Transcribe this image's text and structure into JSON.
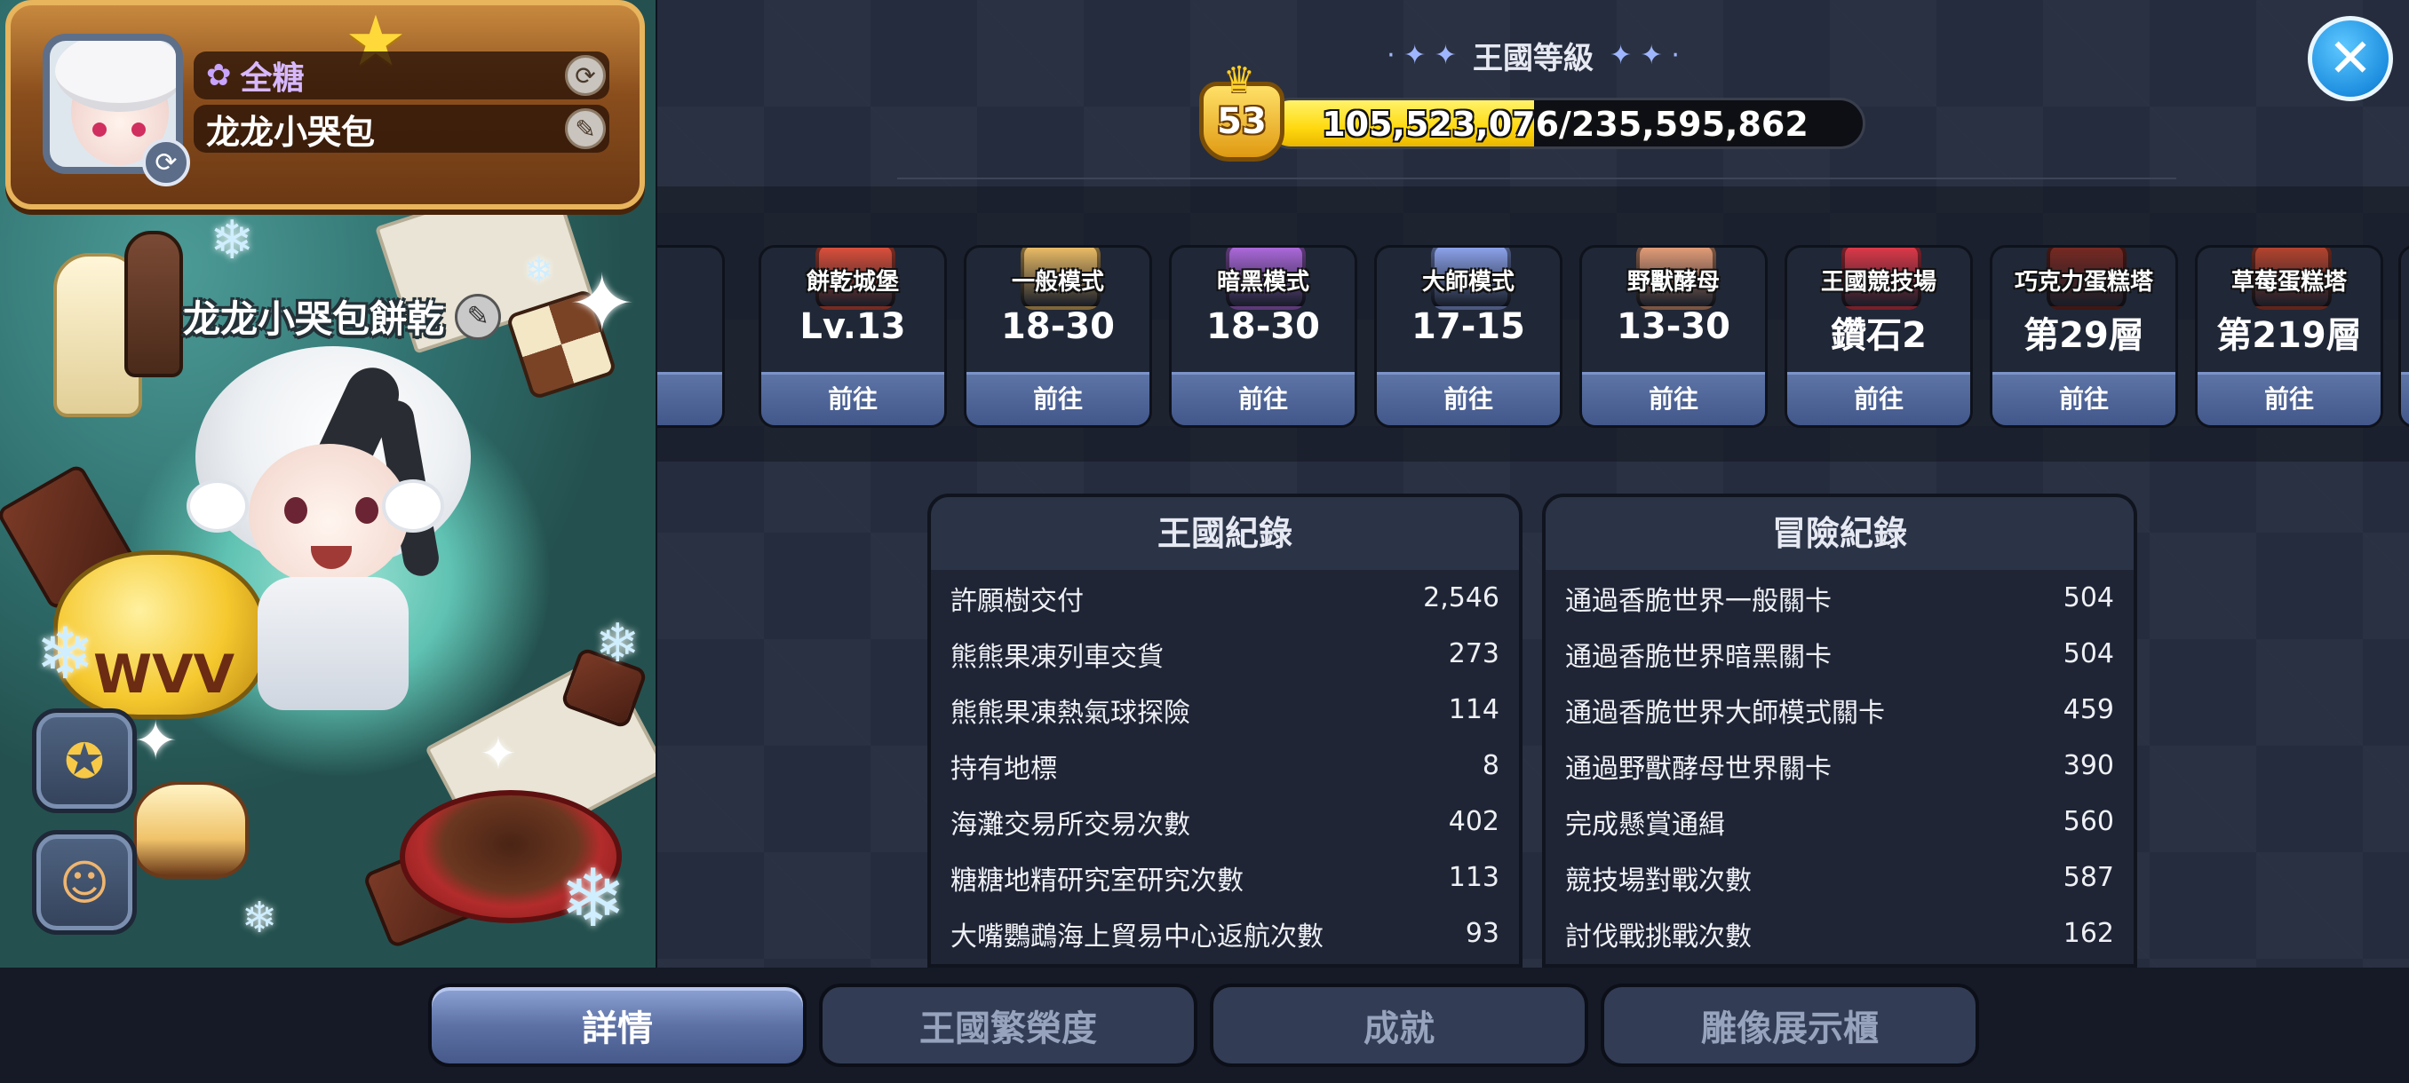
{
  "profile": {
    "title": "全糖",
    "name": "龙龙小哭包",
    "cookie_name": "龙龙小哭包餅乾"
  },
  "kingdom_level": {
    "header": "王國等級",
    "level": "53",
    "xp_text": "105,523,076/235,595,862",
    "xp_fraction": 0.448
  },
  "modes": [
    {
      "label": "餅乾城堡",
      "value": "Lv.13",
      "go": "前往",
      "icon": "castle-icon",
      "color": "#e0513c"
    },
    {
      "label": "一般模式",
      "value": "18-30",
      "go": "前往",
      "icon": "map-icon",
      "color": "#f0c067"
    },
    {
      "label": "暗黑模式",
      "value": "18-30",
      "go": "前往",
      "icon": "dark-map-icon",
      "color": "#b06be0"
    },
    {
      "label": "大師模式",
      "value": "17-15",
      "go": "前往",
      "icon": "master-map-icon",
      "color": "#8fa6f0"
    },
    {
      "label": "野獸酵母",
      "value": "13-30",
      "go": "前往",
      "icon": "beast-map-icon",
      "color": "#e8a07a"
    },
    {
      "label": "王國競技場",
      "value": "鑽石2",
      "go": "前往",
      "icon": "arena-icon",
      "color": "#e23a4a"
    },
    {
      "label": "巧克力蛋糕塔",
      "value": "第29層",
      "go": "前往",
      "icon": "chocolate-tower-icon",
      "color": "#7a2a22"
    },
    {
      "label": "草莓蛋糕塔",
      "value": "第219層",
      "go": "前往",
      "icon": "strawberry-tower-icon",
      "color": "#b8452f"
    }
  ],
  "kingdom_record": {
    "title": "王國紀錄",
    "rows": [
      {
        "label": "許願樹交付",
        "value": "2,546"
      },
      {
        "label": "熊熊果凍列車交貨",
        "value": "273"
      },
      {
        "label": "熊熊果凍熱氣球探險",
        "value": "114"
      },
      {
        "label": "持有地標",
        "value": "8"
      },
      {
        "label": "海灘交易所交易次數",
        "value": "402"
      },
      {
        "label": "糖糖地精研究室研究次數",
        "value": "113"
      },
      {
        "label": "大嘴鸚鵡海上貿易中心返航次數",
        "value": "93"
      }
    ]
  },
  "adventure_record": {
    "title": "冒險紀錄",
    "rows": [
      {
        "label": "通過香脆世界一般關卡",
        "value": "504"
      },
      {
        "label": "通過香脆世界暗黑關卡",
        "value": "504"
      },
      {
        "label": "通過香脆世界大師模式關卡",
        "value": "459"
      },
      {
        "label": "通過野獸酵母世界關卡",
        "value": "390"
      },
      {
        "label": "完成懸賞通緝",
        "value": "560"
      },
      {
        "label": "競技場對戰次數",
        "value": "587"
      },
      {
        "label": "討伐戰挑戰次數",
        "value": "162"
      }
    ]
  },
  "tabs": [
    {
      "label": "詳情",
      "active": true
    },
    {
      "label": "王國繁榮度",
      "active": false
    },
    {
      "label": "成就",
      "active": false
    },
    {
      "label": "雕像展示櫃",
      "active": false
    }
  ],
  "colors": {
    "accent_blue": "#1e8fe0",
    "xp_yellow": "#ffd90f",
    "panel_dark": "#1f2535"
  }
}
